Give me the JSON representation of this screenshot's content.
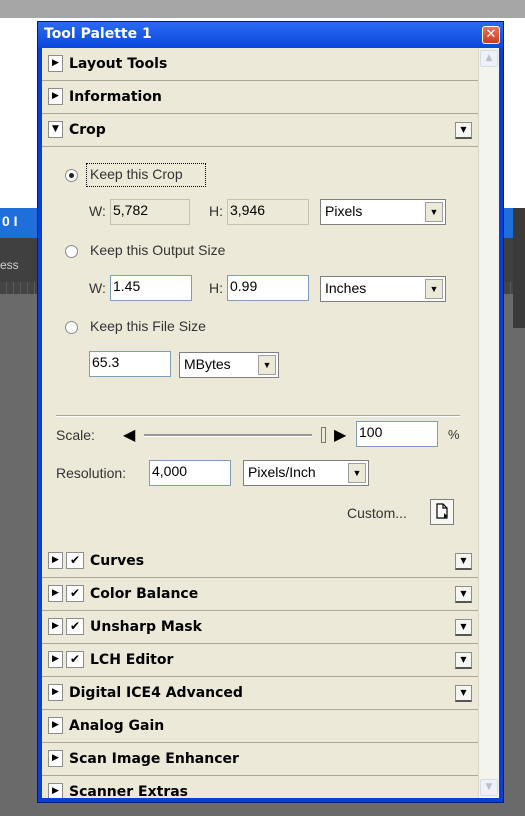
{
  "background": {
    "partial_title": "0 I",
    "partial_label": "ess"
  },
  "palette": {
    "title": "Tool Palette 1",
    "close_glyph": "✕"
  },
  "sections_top": [
    {
      "label": "Layout Tools",
      "arrow": "▶"
    },
    {
      "label": "Information",
      "arrow": "▶"
    }
  ],
  "crop_header": {
    "label": "Crop",
    "arrow": "▼",
    "menu": "▼"
  },
  "crop": {
    "keep_crop": {
      "label": "Keep this Crop",
      "selected": true,
      "w_label": "W:",
      "w_value": "5,782",
      "h_label": "H:",
      "h_value": "3,946",
      "unit": "Pixels"
    },
    "keep_output": {
      "label": "Keep this Output Size",
      "selected": false,
      "w_label": "W:",
      "w_value": "1.45",
      "h_label": "H:",
      "h_value": "0.99",
      "unit": "Inches"
    },
    "keep_file": {
      "label": "Keep this File Size",
      "selected": false,
      "value": "65.3",
      "unit": "MBytes"
    },
    "scale": {
      "label": "Scale:",
      "value": "100",
      "unit": "%"
    },
    "resolution": {
      "label": "Resolution:",
      "value": "4,000",
      "unit": "Pixels/Inch"
    },
    "custom": {
      "label": "Custom..."
    }
  },
  "sections_bottom": [
    {
      "label": "Curves",
      "checked": true,
      "menu": true
    },
    {
      "label": "Color Balance",
      "checked": true,
      "menu": true
    },
    {
      "label": "Unsharp Mask",
      "checked": true,
      "menu": true
    },
    {
      "label": "LCH Editor",
      "checked": true,
      "menu": true
    },
    {
      "label": "Digital ICE4 Advanced",
      "checked": false,
      "menu": true
    },
    {
      "label": "Analog Gain",
      "checked": false,
      "menu": false
    },
    {
      "label": "Scan Image Enhancer",
      "checked": false,
      "menu": false
    },
    {
      "label": "Scanner Extras",
      "checked": false,
      "menu": false
    }
  ],
  "glyphs": {
    "arrow_right": "▶",
    "arrow_down": "▼",
    "check": "✔",
    "scroll_up": "▲",
    "scroll_down": "▼",
    "left": "◀",
    "right": "▶"
  }
}
